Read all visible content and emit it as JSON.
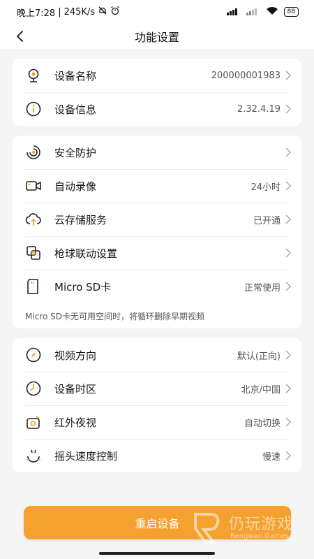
{
  "status_bar": {
    "time": "晚上7:28",
    "speed": "245K/s",
    "battery": "88"
  },
  "nav": {
    "title": "功能设置"
  },
  "card1": {
    "items": [
      {
        "label": "设备名称",
        "value": "200000001983",
        "icon": "webcam-icon"
      },
      {
        "label": "设备信息",
        "value": "2.32.4.19",
        "icon": "info-icon"
      }
    ]
  },
  "card2": {
    "items": [
      {
        "label": "安全防护",
        "value": "",
        "icon": "security-swirl-icon"
      },
      {
        "label": "自动录像",
        "value": "24小时",
        "icon": "video-camera-icon"
      },
      {
        "label": "云存储服务",
        "value": "已开通",
        "icon": "cloud-upload-icon"
      },
      {
        "label": "枪球联动设置",
        "value": "",
        "icon": "linked-squares-icon"
      },
      {
        "label": "Micro SD卡",
        "value": "正常使用",
        "icon": "sd-card-icon"
      }
    ],
    "note": "Micro SD卡无可用空间时，将循环删除早期视频"
  },
  "card3": {
    "items": [
      {
        "label": "视频方向",
        "value": "默认(正向)",
        "icon": "compass-icon"
      },
      {
        "label": "设备时区",
        "value": "北京/中国",
        "icon": "clock-icon"
      },
      {
        "label": "红外夜视",
        "value": "自动切换",
        "icon": "night-vision-icon"
      },
      {
        "label": "摇头速度控制",
        "value": "慢速",
        "icon": "pan-speed-icon"
      }
    ]
  },
  "restart_button": "重启设备",
  "watermark": {
    "title": "仍玩游戏",
    "subtitle": "Rengwan Games"
  },
  "colors": {
    "accent": "#f4a12f",
    "icon_stroke": "#222222"
  }
}
